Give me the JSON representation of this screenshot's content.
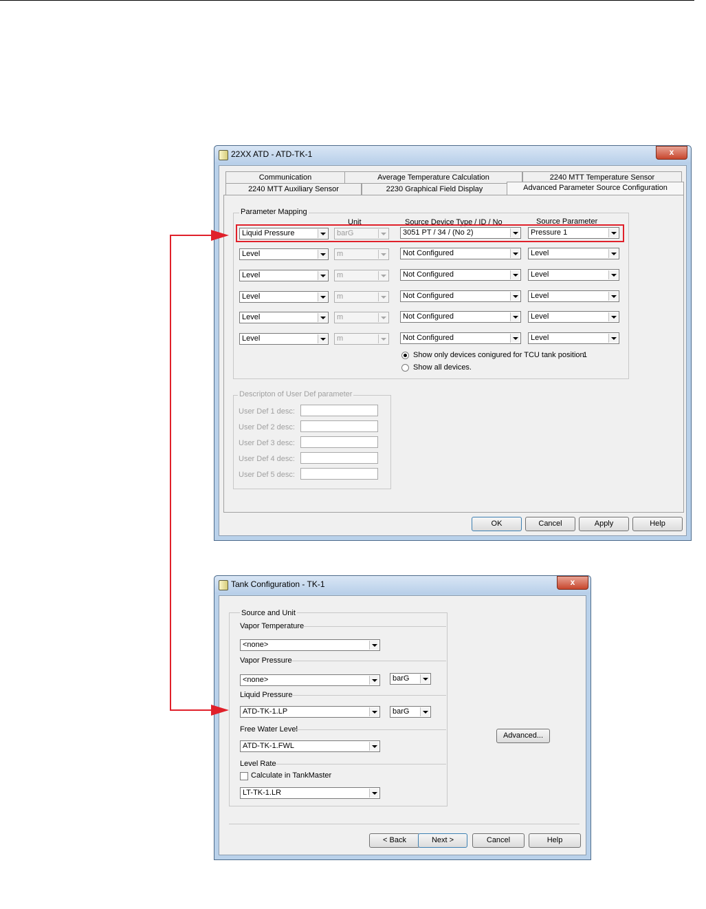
{
  "atd_dialog": {
    "title": "22XX ATD  - ATD-TK-1",
    "close_label": "x",
    "tabs_back": [
      "Communication",
      "Average Temperature Calculation",
      "2240 MTT Temperature Sensor"
    ],
    "tabs_front": [
      "2240 MTT Auxiliary Sensor",
      "2230 Graphical Field Display",
      "Advanced Parameter Source Configuration"
    ],
    "group_title": "Parameter Mapping",
    "headers": {
      "unit": "Unit",
      "source_device": "Source Device Type / ID / No",
      "source_param": "Source Parameter"
    },
    "rows": [
      {
        "param": "Liquid Pressure",
        "unit": "barG",
        "device": "3051 PT / 34 / (No 2)",
        "source": "Pressure 1"
      },
      {
        "param": "Level",
        "unit": "m",
        "device": "Not Configured",
        "source": "Level"
      },
      {
        "param": "Level",
        "unit": "m",
        "device": "Not Configured",
        "source": "Level"
      },
      {
        "param": "Level",
        "unit": "m",
        "device": "Not Configured",
        "source": "Level"
      },
      {
        "param": "Level",
        "unit": "m",
        "device": "Not Configured",
        "source": "Level"
      },
      {
        "param": "Level",
        "unit": "m",
        "device": "Not Configured",
        "source": "Level"
      }
    ],
    "radio_show_only": "Show only devices conigured for TCU tank position:",
    "tank_position": "1",
    "radio_show_all": "Show all devices.",
    "userdef_group": "Descripton of User Def parameter",
    "userdef_labels": [
      "User Def 1 desc:",
      "User Def 2 desc:",
      "User Def 3 desc:",
      "User Def 4 desc:",
      "User Def 5 desc:"
    ],
    "buttons": {
      "ok": "OK",
      "cancel": "Cancel",
      "apply": "Apply",
      "help": "Help"
    }
  },
  "tank_dialog": {
    "title": "Tank Configuration - TK-1",
    "close_label": "x",
    "group_title": "Source and Unit",
    "vapor_temp": {
      "label": "Vapor Temperature",
      "value": "<none>"
    },
    "vapor_pressure": {
      "label": "Vapor Pressure",
      "value": "<none>",
      "unit": "barG"
    },
    "liquid_pressure": {
      "label": "Liquid Pressure",
      "value": "ATD-TK-1.LP",
      "unit": "barG"
    },
    "free_water": {
      "label": "Free Water Level",
      "value": "ATD-TK-1.FWL"
    },
    "level_rate": {
      "label": "Level Rate",
      "checkbox": "Calculate in TankMaster",
      "value": "LT-TK-1.LR"
    },
    "advanced": "Advanced...",
    "buttons": {
      "back": "< Back",
      "next": "Next >",
      "cancel": "Cancel",
      "help": "Help"
    }
  },
  "colors": {
    "highlight": "#e0202a",
    "arrow": "#e0202a"
  }
}
